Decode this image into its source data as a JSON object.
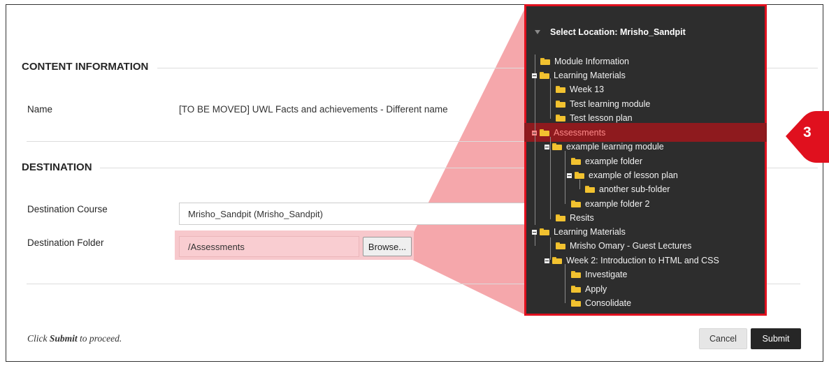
{
  "sections": {
    "content_information": "CONTENT INFORMATION",
    "destination": "DESTINATION"
  },
  "name_field": {
    "label": "Name",
    "value": "[TO BE MOVED] UWL Facts and achievements - Different name"
  },
  "destination_course": {
    "label": "Destination Course",
    "value": "Mrisho_Sandpit (Mrisho_Sandpit)"
  },
  "destination_folder": {
    "label": "Destination Folder",
    "value": "/Assessments",
    "browse_label": "Browse..."
  },
  "footer": {
    "prefix": "Click ",
    "bold": "Submit",
    "suffix": " to proceed.",
    "cancel_label": "Cancel",
    "submit_label": "Submit"
  },
  "tree_panel": {
    "header": "Select Location: Mrisho_Sandpit",
    "items": [
      {
        "label": "Module Information"
      },
      {
        "label": "Learning Materials"
      },
      {
        "label": "Week 13"
      },
      {
        "label": "Test learning module"
      },
      {
        "label": "Test lesson plan"
      },
      {
        "label": "Assessments"
      },
      {
        "label": "example learning module"
      },
      {
        "label": "example folder"
      },
      {
        "label": "example of lesson plan"
      },
      {
        "label": "another sub-folder"
      },
      {
        "label": "example folder 2"
      },
      {
        "label": "Resits"
      },
      {
        "label": "Learning Materials"
      },
      {
        "label": "Mrisho Omary - Guest Lectures"
      },
      {
        "label": "Week 2: Introduction to HTML and CSS"
      },
      {
        "label": "Investigate"
      },
      {
        "label": "Apply"
      },
      {
        "label": "Consolidate"
      }
    ],
    "selected_color": "#8e1a1e",
    "selected_text_color": "#ff8a8a"
  },
  "callout": {
    "number": "3",
    "color": "#e0101e"
  }
}
